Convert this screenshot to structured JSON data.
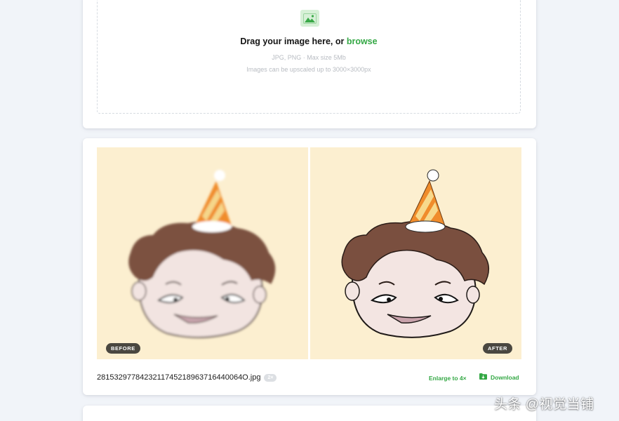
{
  "upload": {
    "title_prefix": "Drag your image here, or ",
    "browse_label": "browse",
    "formats": "JPG, PNG · Max size 5Mb",
    "limit": "Images can be upscaled up to 3000×3000px",
    "icon": "image-icon"
  },
  "result": {
    "before_label": "BEFORE",
    "after_label": "AFTER",
    "filename": "2815329778423211745218963716440064O.jpg",
    "scale_badge": "2×",
    "enlarge_label": "Enlarge to 4×",
    "download_label": "Download",
    "download_icon": "download-folder-icon"
  },
  "watermark": {
    "text": "头条 @视觉当铺"
  },
  "colors": {
    "accent": "#34a845",
    "page_background": "#f1f4f9",
    "preview_background": "#fcefd0"
  }
}
